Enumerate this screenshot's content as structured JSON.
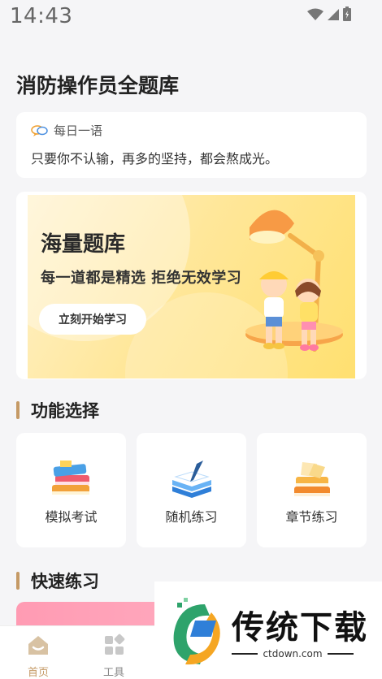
{
  "status_bar": {
    "time": "14:43"
  },
  "page": {
    "title": "消防操作员全题库"
  },
  "daily_quote": {
    "title": "每日一语",
    "text": "只要你不认输，再多的坚持，都会熬成光。"
  },
  "banner": {
    "title": "海量题库",
    "subtitle": "每一道都是精选  拒绝无效学习",
    "button_label": "立刻开始学习"
  },
  "function_section": {
    "title": "功能选择",
    "items": [
      {
        "label": "模拟考试",
        "icon": "books-stack-icon"
      },
      {
        "label": "随机练习",
        "icon": "notebook-pen-icon"
      },
      {
        "label": "章节练习",
        "icon": "books-pages-icon"
      }
    ]
  },
  "quick_section": {
    "title": "快速练习"
  },
  "nav": {
    "items": [
      {
        "label": "首页",
        "icon": "home-icon",
        "active": true
      },
      {
        "label": "工具",
        "icon": "grid-icon",
        "active": false
      }
    ],
    "active_color": "#c59a66",
    "inactive_color": "#888888"
  },
  "watermark": {
    "brand": "传统下载",
    "url": "ctdown.com"
  },
  "colors": {
    "accent": "#c59a66",
    "background": "#f5f5f7",
    "banner_yellow": "#ffe070",
    "practice_pink": "#ff9bb3"
  }
}
